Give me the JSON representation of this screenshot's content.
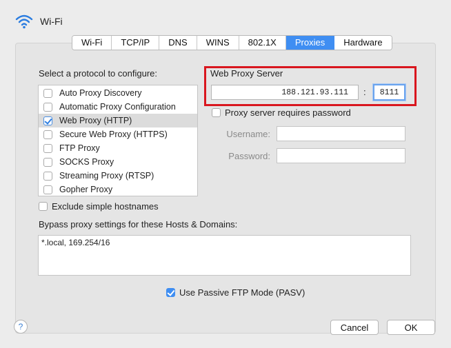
{
  "window": {
    "title": "Wi-Fi",
    "icon": "wifi-icon"
  },
  "tabs": [
    {
      "label": "Wi-Fi",
      "active": false
    },
    {
      "label": "TCP/IP",
      "active": false
    },
    {
      "label": "DNS",
      "active": false
    },
    {
      "label": "WINS",
      "active": false
    },
    {
      "label": "802.1X",
      "active": false
    },
    {
      "label": "Proxies",
      "active": true
    },
    {
      "label": "Hardware",
      "active": false
    }
  ],
  "protocols": {
    "heading": "Select a protocol to configure:",
    "items": [
      {
        "label": "Auto Proxy Discovery",
        "checked": false,
        "selected": false
      },
      {
        "label": "Automatic Proxy Configuration",
        "checked": false,
        "selected": false
      },
      {
        "label": "Web Proxy (HTTP)",
        "checked": true,
        "selected": true
      },
      {
        "label": "Secure Web Proxy (HTTPS)",
        "checked": false,
        "selected": false
      },
      {
        "label": "FTP Proxy",
        "checked": false,
        "selected": false
      },
      {
        "label": "SOCKS Proxy",
        "checked": false,
        "selected": false
      },
      {
        "label": "Streaming Proxy (RTSP)",
        "checked": false,
        "selected": false
      },
      {
        "label": "Gopher Proxy",
        "checked": false,
        "selected": false
      }
    ]
  },
  "proxy_server": {
    "heading": "Web Proxy Server",
    "address": "188.121.93.111",
    "separator": ":",
    "port": "8111",
    "requires_password_label": "Proxy server requires password",
    "requires_password": false,
    "username_label": "Username:",
    "username": "",
    "password_label": "Password:",
    "password": ""
  },
  "exclude_simple": {
    "label": "Exclude simple hostnames",
    "checked": false
  },
  "bypass": {
    "label": "Bypass proxy settings for these Hosts & Domains:",
    "value": "*.local, 169.254/16"
  },
  "passive_ftp": {
    "label": "Use Passive FTP Mode (PASV)",
    "checked": true
  },
  "buttons": {
    "help": "?",
    "cancel": "Cancel",
    "ok": "OK"
  },
  "colors": {
    "accent": "#3f8ef2",
    "highlight_border": "#d9161e"
  }
}
